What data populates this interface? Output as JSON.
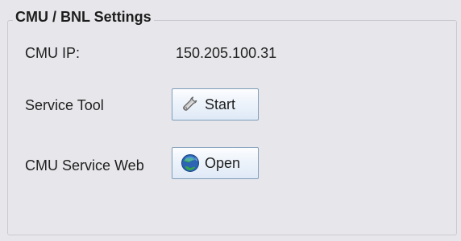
{
  "group": {
    "title": "CMU / BNL Settings"
  },
  "rows": {
    "ip": {
      "label": "CMU IP:",
      "value": "150.205.100.31"
    },
    "service_tool": {
      "label": "Service Tool",
      "button_label": "Start",
      "icon": "wrench-icon"
    },
    "service_web": {
      "label": "CMU Service Web",
      "button_label": "Open",
      "icon": "browser-globe-icon"
    }
  },
  "colors": {
    "panel_background": "#e7e7eb",
    "button_border": "#7f9db9",
    "button_gradient_top": "#fcfdff",
    "button_gradient_bottom": "#dfe9f6",
    "globe_blue": "#2d64b3",
    "globe_green": "#36a548"
  }
}
